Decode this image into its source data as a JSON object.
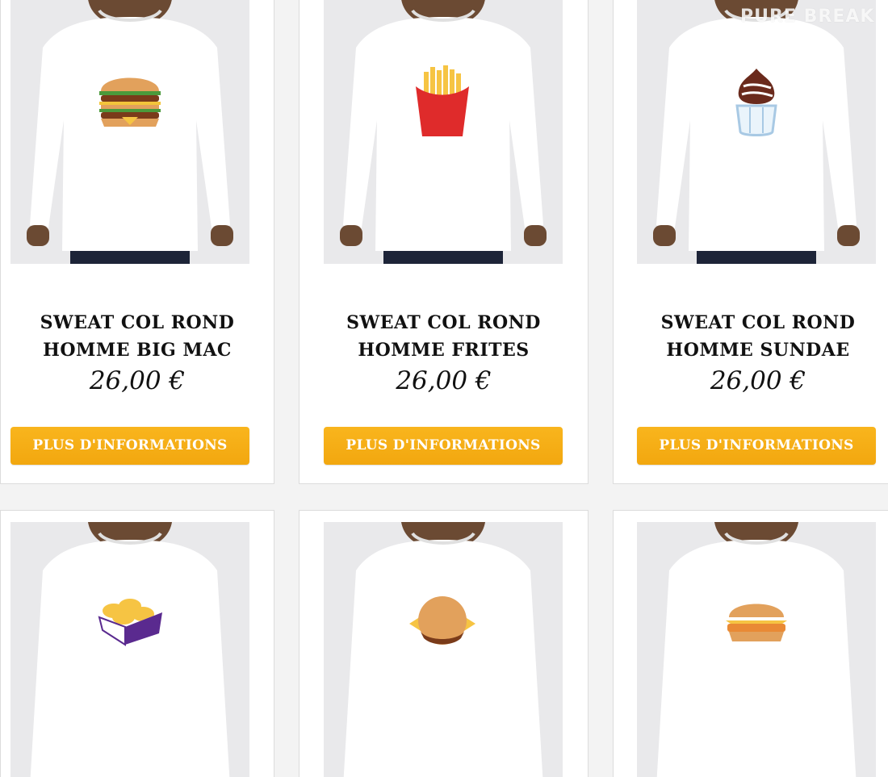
{
  "watermark": "PURE BREAK",
  "colors": {
    "button": "#f4aa12",
    "button_text": "#ffffff",
    "card_bg": "#ffffff",
    "page_bg": "#f3f3f3"
  },
  "products": [
    {
      "title_line1": "SWEAT COL ROND",
      "title_line2": "HOMME BIG MAC",
      "price": "26,00 €",
      "button": "PLUS D'INFORMATIONS",
      "graphic": "big-mac-icon"
    },
    {
      "title_line1": "SWEAT COL ROND",
      "title_line2": "HOMME FRITES",
      "price": "26,00 €",
      "button": "PLUS D'INFORMATIONS",
      "graphic": "fries-icon"
    },
    {
      "title_line1": "SWEAT COL ROND",
      "title_line2": "HOMME SUNDAE",
      "price": "26,00 €",
      "button": "PLUS D'INFORMATIONS",
      "graphic": "sundae-icon"
    },
    {
      "graphic": "nuggets-icon"
    },
    {
      "graphic": "cheeseburger-icon"
    },
    {
      "graphic": "filet-o-fish-icon"
    }
  ]
}
